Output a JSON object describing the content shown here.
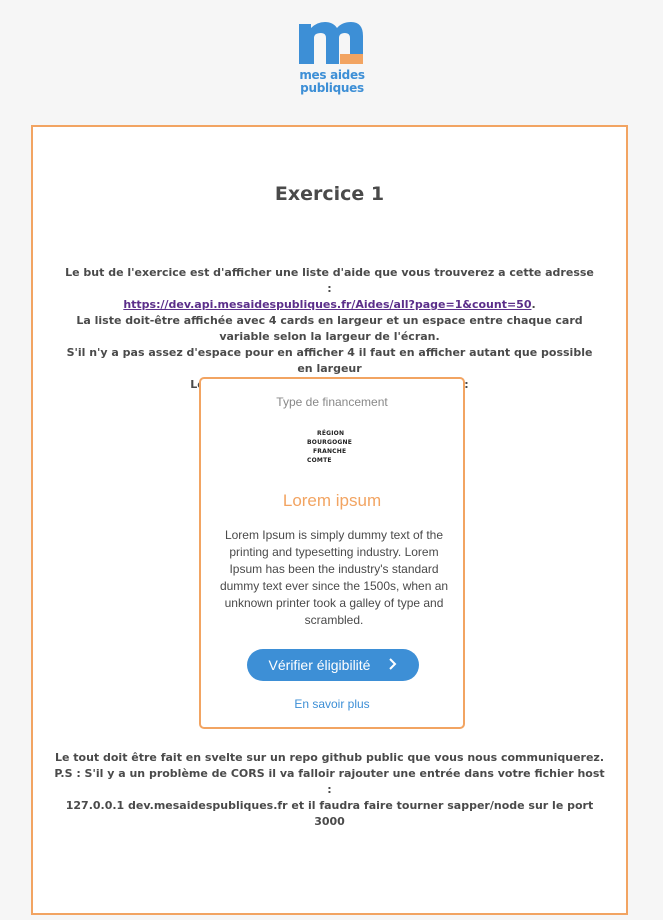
{
  "logo": {
    "icon": "m-logo-icon",
    "line1": "mes aides",
    "line2": "publiques",
    "colors": {
      "blue": "#3d8fd6",
      "orange": "#f2a462"
    }
  },
  "exercise": {
    "title": "Exercice 1",
    "intro_text": "Le but de l'exercice est d'afficher une liste d'aide que vous trouverez a cette adresse :",
    "link_text": "https://dev.api.mesaidespubliques.fr/Aides/all?page=1&count=50",
    "link_suffix": ".",
    "line2": "La liste doit-être affichée avec 4 cards en largeur et un espace entre chaque card variable selon la largeur de l'écran.",
    "line3": "S'il n'y a pas assez d'espace pour en afficher 4 il faut en afficher autant que possible en largeur",
    "line4": "Le tout en respectant la maquette suivante :"
  },
  "card": {
    "type_label": "Type de financement",
    "region_logo": {
      "line1": "RÉGION",
      "line2": "BOURGOGNE",
      "line3": "FRANCHE",
      "line4": "COMTE"
    },
    "title": "Lorem ipsum",
    "description": "Lorem Ipsum is simply dummy text of the printing and typesetting industry. Lorem Ipsum has been the industry's standard dummy text ever since the 1500s, when an unknown printer took a galley of type and scrambled.",
    "button_label": "Vérifier éligibilité",
    "button_icon": "chevron-right-icon",
    "more_link": "En savoir plus"
  },
  "outro": {
    "line1": "Le tout doit être fait en svelte sur un repo github public que vous nous communiquerez.",
    "line2": "P.S : S'il y a un problème de CORS il va falloir rajouter une entrée dans votre fichier host :",
    "line3": "127.0.0.1 dev.mesaidespubliques.fr et il faudra faire tourner sapper/node sur le port 3000"
  }
}
